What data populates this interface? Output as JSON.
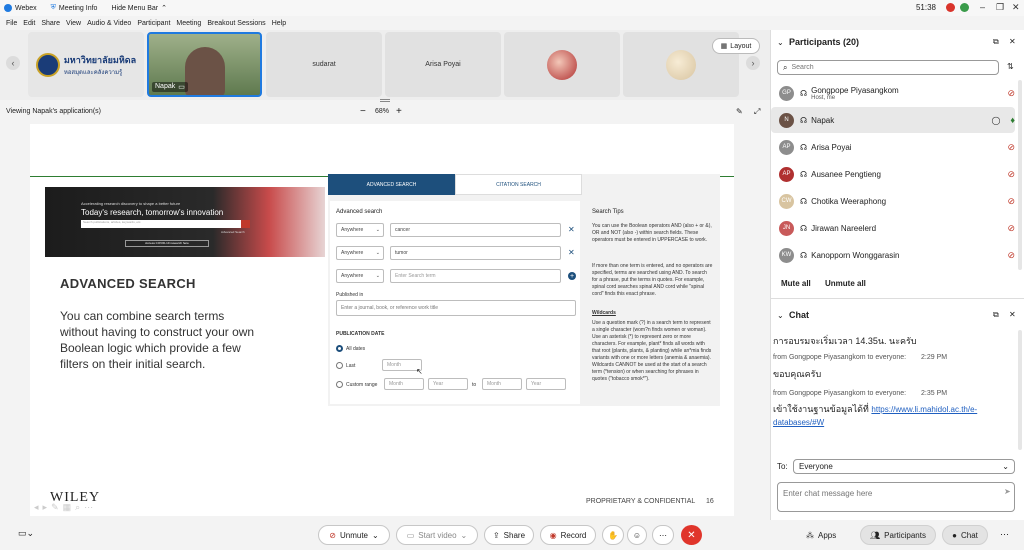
{
  "titlebar": {
    "app_name": "Webex",
    "meeting_info": "Meeting Info",
    "hide_menu": "Hide Menu Bar",
    "clock": "51:38"
  },
  "menu": [
    "File",
    "Edit",
    "Share",
    "View",
    "Audio & Video",
    "Participant",
    "Meeting",
    "Breakout Sessions",
    "Help"
  ],
  "thumbnails": {
    "logo_text_1": "มหาวิทยาลัยมหิดล",
    "logo_text_2": "หอสมุดและคลังความรู้",
    "active_name": "Napak",
    "t1": "sudarat",
    "t2": "Arisa Poyai"
  },
  "layout_label": "Layout",
  "viewbar": {
    "viewing": "Viewing Napak's application(s)",
    "zoom": "68%",
    "minus": "−",
    "plus": "+"
  },
  "slide": {
    "banner_line1": "Accelerating research discovery to shape a better future",
    "banner_line2": "Today's research, tomorrow's innovation",
    "banner_search_ph": "Search publications, articles, keywords, etc.",
    "banner_adv": "Advanced Search",
    "banner_covid": "Access COVID-19 research here",
    "title": "ADVANCED SEARCH",
    "body": "You can combine search terms without having to construct your own Boolean logic which provide a few filters on their initial search.",
    "wiley": "WILEY",
    "footer": "PROPRIETARY & CONFIDENTIAL",
    "page": "16",
    "tab_adv": "ADVANCED SEARCH",
    "tab_cit": "CITATION SEARCH",
    "adv_heading": "Advanced search",
    "anywhere": "Anywhere",
    "term1": "cancer",
    "term2": "tumor",
    "term3_ph": "Enter Search term",
    "published_in": "Published in",
    "journal_ph": "Enter a journal, book, or reference work title",
    "pub_date": "PUBLICATION DATE",
    "all_dates": "All dates",
    "last": "Last",
    "month": "Month",
    "custom_range": "Custom range",
    "year": "Year",
    "to": "to",
    "tips_title": "Search Tips",
    "tips_p1": "You can use the Boolean operators AND (also + or &), OR and NOT (also -) within search fields. These operators must be entered in UPPERCASE to work.",
    "tips_p2": "If more than one term is entered, and no operators are specified, terms are searched using AND. To search for a phrase, put the terms in quotes. For example, spinal cord searches spinal AND cord while \"spinal cord\" finds this exact phrase.",
    "wildcards": "Wildcards",
    "tips_p3": "Use a question mark (?) in a search term to represent a single character (wom?n finds women or woman). Use an asterisk (*) to represent zero or more characters. For example, plant* finds all words with that root (plants, plants, & planting) while an*mia finds variants with one or more letters (anemia & anaemia). Wildcards CANNOT be used at the start of a search term (*tension) or when searching for phrases in quotes (\"tobacco smok*\")."
  },
  "participants": {
    "header": "Participants (20)",
    "search_ph": "Search",
    "list": [
      {
        "initials": "GP",
        "name": "Gongpope Piyasangkom",
        "sub": "Host, me"
      },
      {
        "initials": "N",
        "name": "Napak",
        "sub": ""
      },
      {
        "initials": "AP",
        "name": "Arisa Poyai",
        "sub": ""
      },
      {
        "initials": "AP",
        "name": "Ausanee Pengtieng",
        "sub": ""
      },
      {
        "initials": "CW",
        "name": "Chotika Weeraphong",
        "sub": ""
      },
      {
        "initials": "JN",
        "name": "Jirawan Nareelerd",
        "sub": ""
      },
      {
        "initials": "KW",
        "name": "Kanopporn Wonggarasin",
        "sub": ""
      }
    ],
    "mute_all": "Mute all",
    "unmute_all": "Unmute all"
  },
  "chat": {
    "header": "Chat",
    "msg0": "การอบรมจะเริ่มเวลา 14.35น. นะครับ",
    "m1_from": "from Gongpope Piyasangkom to everyone:",
    "m1_time": "2:29 PM",
    "m1_text": "ขอบคุณครับ",
    "m2_from": "from Gongpope Piyasangkom to everyone:",
    "m2_time": "2:35 PM",
    "m2_text": "เข้าใช้งานฐานข้อมูลได้ที่",
    "m2_link": "https://www.li.mahidol.ac.th/e-databases/#W",
    "to_label": "To:",
    "to_value": "Everyone",
    "input_ph": "Enter chat message here"
  },
  "bottom": {
    "unmute": "Unmute",
    "start_video": "Start video",
    "share": "Share",
    "record": "Record",
    "apps": "Apps",
    "participants": "Participants",
    "chat": "Chat"
  }
}
